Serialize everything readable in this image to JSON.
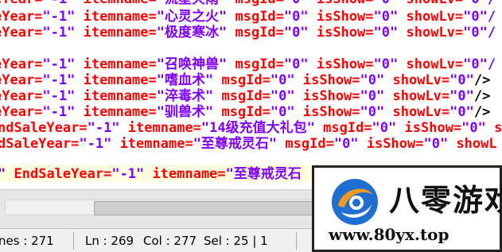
{
  "editor": {
    "lines": [
      {
        "segments": [
          [
            "attr",
            "eYear="
          ],
          [
            "str",
            "\"-1\""
          ],
          [
            "plain",
            " "
          ],
          [
            "attr",
            "itemname="
          ],
          [
            "str",
            "\"流星火雨\""
          ],
          [
            "plain",
            " "
          ],
          [
            "attr",
            "msgId="
          ],
          [
            "str",
            "\"0\""
          ],
          [
            "plain",
            " "
          ],
          [
            "attr",
            "isShow="
          ],
          [
            "str",
            "\"0\""
          ],
          [
            "plain",
            " "
          ],
          [
            "attr",
            "showLv="
          ],
          [
            "str",
            "\"0\"/"
          ]
        ]
      },
      {
        "segments": [
          [
            "attr",
            "eYear="
          ],
          [
            "str",
            "\"-1\""
          ],
          [
            "plain",
            " "
          ],
          [
            "attr",
            "itemname="
          ],
          [
            "str",
            "\"心灵之火\""
          ],
          [
            "plain",
            " "
          ],
          [
            "attr",
            "msgId="
          ],
          [
            "str",
            "\"0\""
          ],
          [
            "plain",
            " "
          ],
          [
            "attr",
            "isShow="
          ],
          [
            "str",
            "\"0\""
          ],
          [
            "plain",
            " "
          ],
          [
            "attr",
            "showLv="
          ],
          [
            "str",
            "\"0\"/"
          ]
        ]
      },
      {
        "segments": [
          [
            "attr",
            "eYear="
          ],
          [
            "str",
            "\"-1\""
          ],
          [
            "plain",
            " "
          ],
          [
            "attr",
            "itemname="
          ],
          [
            "str",
            "\"极度寒冰\""
          ],
          [
            "plain",
            " "
          ],
          [
            "attr",
            "msgId="
          ],
          [
            "str",
            "\"0\""
          ],
          [
            "plain",
            " "
          ],
          [
            "attr",
            "isShow="
          ],
          [
            "str",
            "\"0\""
          ],
          [
            "plain",
            " "
          ],
          [
            "attr",
            "showLv="
          ],
          [
            "str",
            "\"0\"/"
          ]
        ]
      },
      {
        "segments": []
      },
      {
        "segments": [
          [
            "attr",
            "eYear="
          ],
          [
            "str",
            "\"-1\""
          ],
          [
            "plain",
            " "
          ],
          [
            "attr",
            "itemname="
          ],
          [
            "str",
            "\"召唤神兽\""
          ],
          [
            "plain",
            " "
          ],
          [
            "attr",
            "msgId="
          ],
          [
            "str",
            "\"0\""
          ],
          [
            "plain",
            " "
          ],
          [
            "attr",
            "isShow="
          ],
          [
            "str",
            "\"0\""
          ],
          [
            "plain",
            " "
          ],
          [
            "attr",
            "showLv="
          ],
          [
            "str",
            "\"0\"/"
          ]
        ]
      },
      {
        "segments": [
          [
            "attr",
            "eYear="
          ],
          [
            "str",
            "\"-1\""
          ],
          [
            "plain",
            " "
          ],
          [
            "attr",
            "itemname="
          ],
          [
            "str",
            "\"嗜血术\""
          ],
          [
            "plain",
            " "
          ],
          [
            "attr",
            "msgId="
          ],
          [
            "str",
            "\"0\""
          ],
          [
            "plain",
            " "
          ],
          [
            "attr",
            "isShow="
          ],
          [
            "str",
            "\"0\""
          ],
          [
            "plain",
            " "
          ],
          [
            "attr",
            "showLv="
          ],
          [
            "str",
            "\"0\""
          ],
          [
            "plain",
            "/>"
          ]
        ]
      },
      {
        "segments": [
          [
            "attr",
            "eYear="
          ],
          [
            "str",
            "\"-1\""
          ],
          [
            "plain",
            " "
          ],
          [
            "attr",
            "itemname="
          ],
          [
            "str",
            "\"淬毒术\""
          ],
          [
            "plain",
            " "
          ],
          [
            "attr",
            "msgId="
          ],
          [
            "str",
            "\"0\""
          ],
          [
            "plain",
            " "
          ],
          [
            "attr",
            "isShow="
          ],
          [
            "str",
            "\"0\""
          ],
          [
            "plain",
            " "
          ],
          [
            "attr",
            "showLv="
          ],
          [
            "str",
            "\"0\""
          ],
          [
            "plain",
            "/>"
          ]
        ]
      },
      {
        "segments": [
          [
            "attr",
            "eYear="
          ],
          [
            "str",
            "\"-1\""
          ],
          [
            "plain",
            " "
          ],
          [
            "attr",
            "itemname="
          ],
          [
            "str",
            "\"驯兽术\""
          ],
          [
            "plain",
            " "
          ],
          [
            "attr",
            "msgId="
          ],
          [
            "str",
            "\"0\""
          ],
          [
            "plain",
            " "
          ],
          [
            "attr",
            "isShow="
          ],
          [
            "str",
            "\"0\""
          ],
          [
            "plain",
            " "
          ],
          [
            "attr",
            "showLv="
          ],
          [
            "str",
            "\"0\""
          ],
          [
            "plain",
            "/>"
          ]
        ]
      },
      {
        "segments": [
          [
            "attr",
            "ndSaleYear="
          ],
          [
            "str",
            "\"-1\""
          ],
          [
            "plain",
            " "
          ],
          [
            "attr",
            "itemname="
          ],
          [
            "str",
            "\"14级充值大礼包\""
          ],
          [
            "plain",
            " "
          ],
          [
            "attr",
            "msgId="
          ],
          [
            "str",
            "\"0\""
          ],
          [
            "plain",
            " "
          ],
          [
            "attr",
            "isShow="
          ],
          [
            "str",
            "\"0\""
          ],
          [
            "plain",
            " "
          ],
          [
            "attr",
            "s"
          ]
        ]
      },
      {
        "segments": [
          [
            "attr",
            "dSaleYear="
          ],
          [
            "str",
            "\"-1\""
          ],
          [
            "plain",
            " "
          ],
          [
            "attr",
            "itemname="
          ],
          [
            "str",
            "\"至尊戒灵石\""
          ],
          [
            "plain",
            " "
          ],
          [
            "attr",
            "msgId="
          ],
          [
            "str",
            "\"0\""
          ],
          [
            "plain",
            " "
          ],
          [
            "attr",
            "isShow="
          ],
          [
            "str",
            "\"0\""
          ],
          [
            "plain",
            " "
          ],
          [
            "attr",
            "showL"
          ]
        ]
      },
      {
        "segments": [
          [
            "str",
            "\""
          ],
          [
            "plain",
            " "
          ],
          [
            "attr",
            "EndSaleYear="
          ],
          [
            "str",
            "\"-1\""
          ],
          [
            "plain",
            " "
          ],
          [
            "attr",
            "itemname="
          ],
          [
            "str",
            "\"至尊戒灵石"
          ]
        ]
      }
    ]
  },
  "statusbar": {
    "lines": "nes : 271",
    "ln": "Ln : 269",
    "col": "Col : 277",
    "sel": "Sel : 25 | 1"
  },
  "watermark": {
    "brand": "八零游戏",
    "url": "www.80yx.top",
    "colors": {
      "orange": "#f39a1e",
      "blue": "#1e6fd0",
      "white": "#ffffff"
    }
  },
  "colors": {
    "attribute": "#ff0000",
    "string": "#8000ff",
    "plain": "#000000",
    "current_line": "#fffde0"
  }
}
